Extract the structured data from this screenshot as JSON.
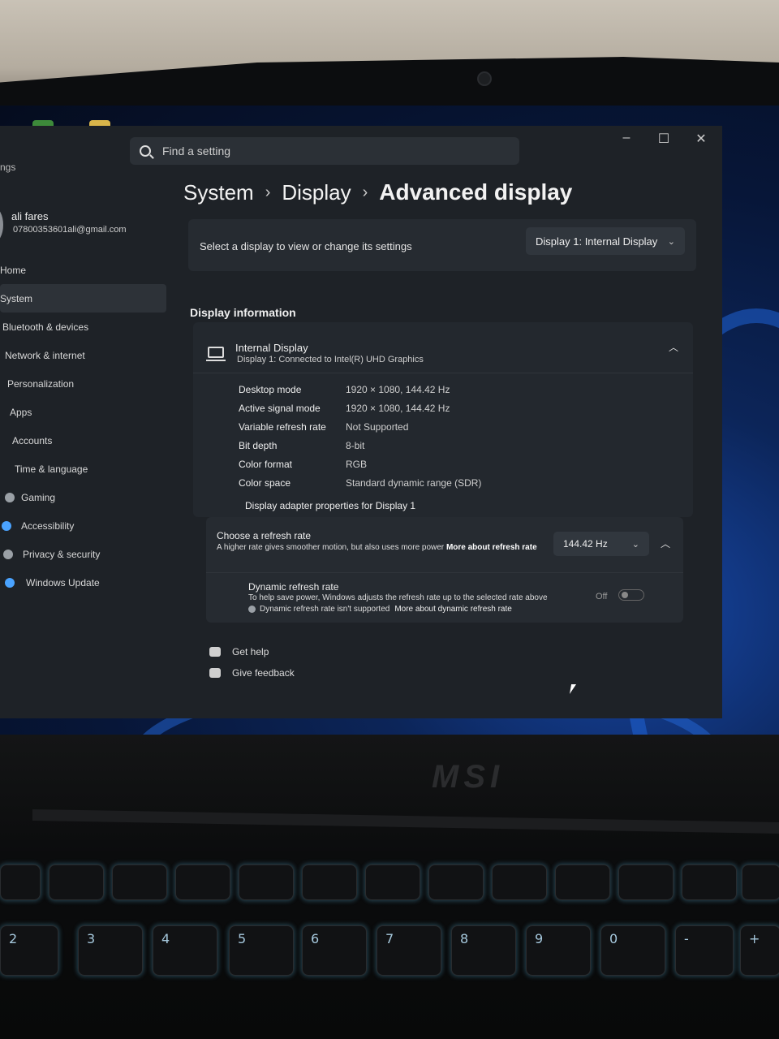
{
  "window": {
    "nav_title_fragment": "ngs",
    "controls": [
      "–",
      "☐",
      "✕"
    ]
  },
  "search": {
    "placeholder": "Find a setting"
  },
  "user": {
    "name": "ali fares",
    "email": "07800353601ali@gmail.com"
  },
  "sidebar": {
    "items": [
      {
        "label": "Home",
        "color": "#7aa7d8"
      },
      {
        "label": "System",
        "color": "#4aa3ff",
        "active": true
      },
      {
        "label": "Bluetooth & devices",
        "color": "#4aa3ff"
      },
      {
        "label": "Network & internet",
        "color": "#6fc1ff"
      },
      {
        "label": "Personalization",
        "color": "#e9a44a"
      },
      {
        "label": "Apps",
        "color": "#8f9aa6"
      },
      {
        "label": "Accounts",
        "color": "#46c07a"
      },
      {
        "label": "Time & language",
        "color": "#4aa3ff"
      },
      {
        "label": "Gaming",
        "color": "#9aa0a6"
      },
      {
        "label": "Accessibility",
        "color": "#4aa3ff"
      },
      {
        "label": "Privacy & security",
        "color": "#9aa0a6"
      },
      {
        "label": "Windows Update",
        "color": "#4aa3ff"
      }
    ]
  },
  "breadcrumb": {
    "items": [
      "System",
      "Display",
      "Advanced display"
    ],
    "separator": "›"
  },
  "display_select": {
    "label": "Select a display to view or change its settings",
    "value": "Display 1: Internal Display"
  },
  "display_info": {
    "section_title": "Display information",
    "name": "Internal Display",
    "subtitle": "Display 1: Connected to Intel(R) UHD Graphics",
    "rows": [
      {
        "label": "Desktop mode",
        "value": "1920 × 1080, 144.42 Hz"
      },
      {
        "label": "Active signal mode",
        "value": "1920 × 1080, 144.42 Hz"
      },
      {
        "label": "Variable refresh rate",
        "value": "Not Supported"
      },
      {
        "label": "Bit depth",
        "value": "8-bit"
      },
      {
        "label": "Color format",
        "value": "RGB"
      },
      {
        "label": "Color space",
        "value": "Standard dynamic range (SDR)"
      }
    ],
    "adapter_link": "Display adapter properties for Display 1"
  },
  "refresh_rate": {
    "title": "Choose a refresh rate",
    "description": "A higher rate gives smoother motion, but also uses more power",
    "link": "More about refresh rate",
    "value": "144.42 Hz"
  },
  "dynamic_refresh": {
    "title": "Dynamic refresh rate",
    "description": "To help save power, Windows adjusts the refresh rate up to the selected rate above",
    "warning": "Dynamic refresh rate isn't supported",
    "link": "More about dynamic refresh rate",
    "toggle_label": "Off",
    "enabled": false
  },
  "help": {
    "get_help": "Get help",
    "give_feedback": "Give feedback"
  },
  "laptop": {
    "brand": "MSI",
    "keys": [
      "2",
      "3",
      "4",
      "5",
      "6",
      "7",
      "8",
      "9",
      "0",
      "-",
      "+"
    ]
  }
}
